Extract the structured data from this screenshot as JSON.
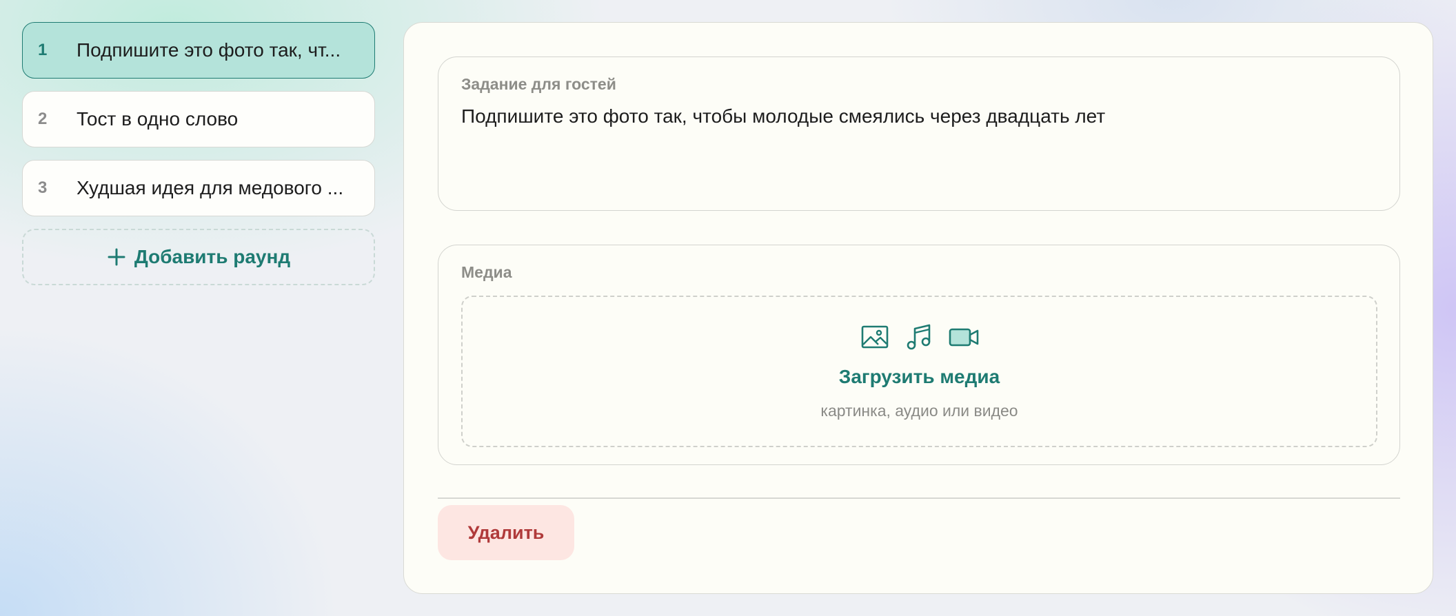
{
  "rounds": [
    {
      "number": "1",
      "title": "Подпишите это фото так, чт..."
    },
    {
      "number": "2",
      "title": "Тост в одно слово"
    },
    {
      "number": "3",
      "title": "Худшая идея для медового ..."
    }
  ],
  "add_round": {
    "icon": "plus-icon",
    "label": "Добавить раунд"
  },
  "task": {
    "label": "Задание для гостей",
    "value": "Подпишите это фото так, чтобы молодые смеялись через двадцать лет"
  },
  "media": {
    "label": "Медиа",
    "icons": [
      "image-icon",
      "music-icon",
      "video-icon"
    ],
    "upload_title": "Загрузить медиа",
    "upload_subtitle": "картинка, аудио или видео"
  },
  "delete_label": "Удалить",
  "colors": {
    "accent": "#1e7b72",
    "active_bg": "#b4e3da",
    "danger": "#b03a3a",
    "danger_bg": "#fde6e2",
    "panel_bg": "#fdfdf7"
  }
}
